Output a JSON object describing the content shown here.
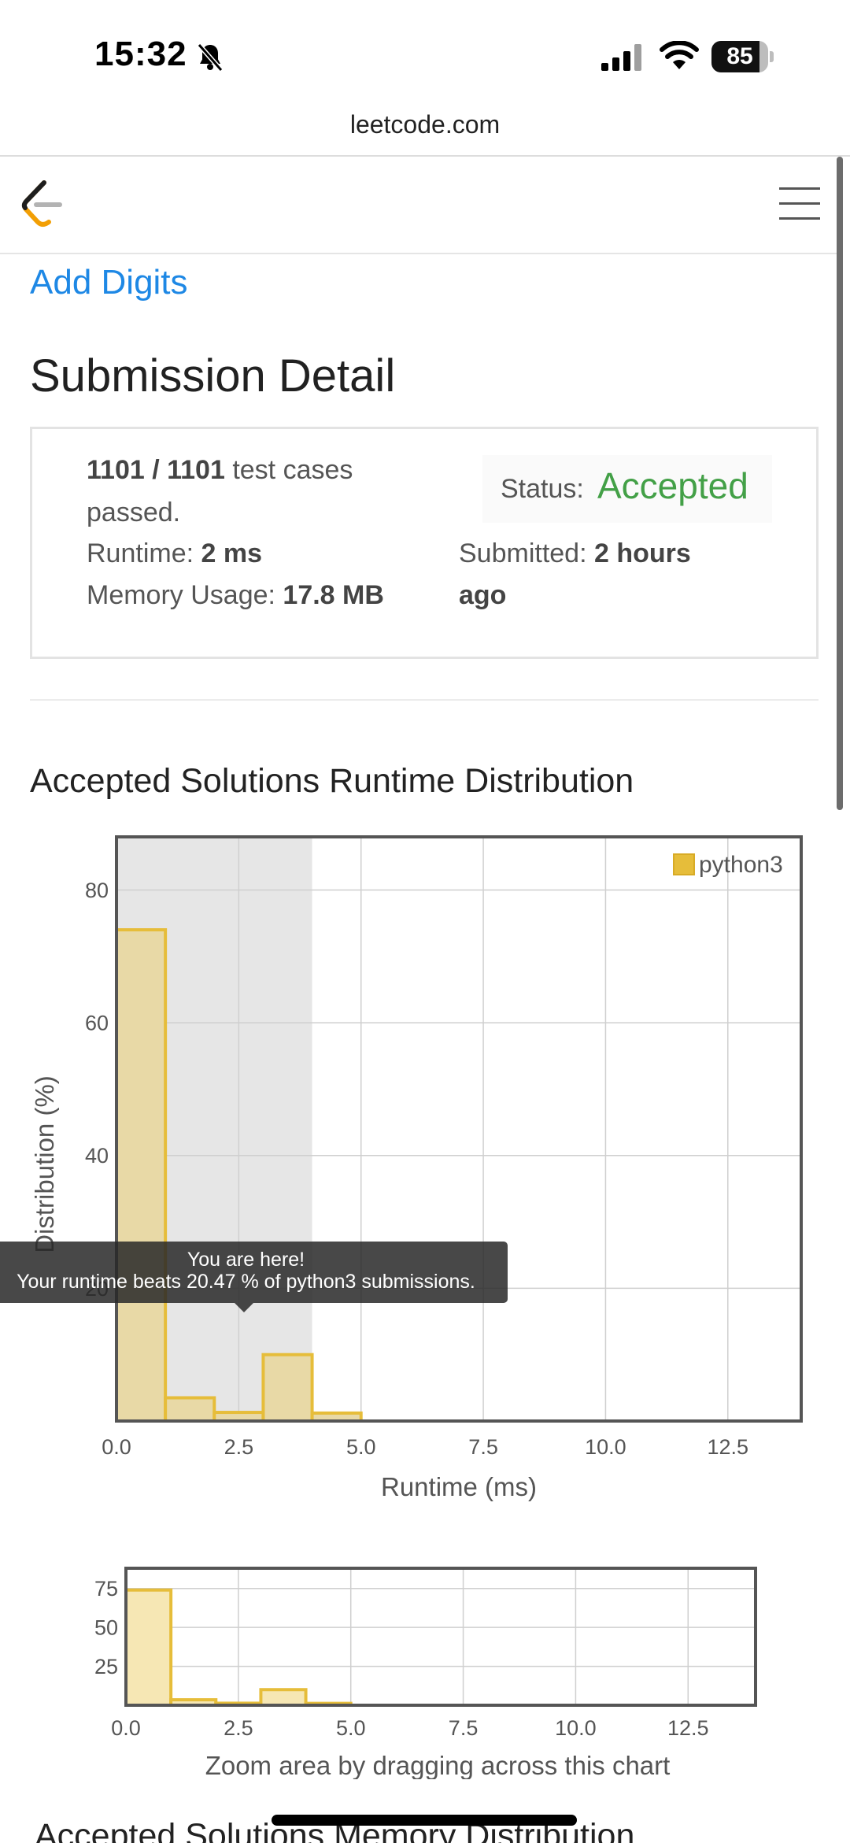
{
  "status_bar": {
    "time": "15:32",
    "battery_level": "85",
    "battery_fraction": 0.85
  },
  "browser": {
    "url": "leetcode.com"
  },
  "header": {
    "logo_icon": "leetcode-logo-icon",
    "menu_icon": "hamburger-menu-icon"
  },
  "problem": {
    "link_label": "Add Digits"
  },
  "page_title": "Submission Detail",
  "submission": {
    "cases_passed": "1101 / 1101",
    "cases_suffix_line1": "test cases",
    "cases_suffix_line2": "passed.",
    "runtime_label": "Runtime:",
    "runtime_value": "2 ms",
    "memory_label": "Memory Usage:",
    "memory_value": "17.8 MB",
    "status_label": "Status:",
    "status_value": "Accepted",
    "submitted_label": "Submitted:",
    "submitted_value_line1": "2 hours",
    "submitted_value_line2": "ago"
  },
  "runtime_section": {
    "title": "Accepted Solutions Runtime Distribution"
  },
  "tooltip": {
    "line1": "You are here!",
    "line2": "Your runtime beats 20.47 % of python3 submissions."
  },
  "chart_data": [
    {
      "type": "bar",
      "title": "",
      "xlabel": "Runtime (ms)",
      "ylabel": "Distribution (%)",
      "x_ticks": [
        "0.0",
        "2.5",
        "5.0",
        "7.5",
        "10.0",
        "12.5"
      ],
      "y_ticks": [
        "20",
        "40",
        "60",
        "80"
      ],
      "xlim": [
        0,
        14
      ],
      "ylim": [
        0,
        88
      ],
      "grid": true,
      "legend_position": "top-right",
      "highlight_range_ms": [
        0,
        4
      ],
      "bins": [
        [
          0,
          1
        ],
        [
          1,
          2
        ],
        [
          2,
          3
        ],
        [
          3,
          4
        ],
        [
          4,
          5
        ]
      ],
      "series": [
        {
          "name": "python3",
          "values": [
            74,
            3.5,
            1.3,
            10,
            1.2
          ]
        }
      ],
      "colors": {
        "bar_fill": "#e8d9a6",
        "bar_stroke": "#e6bd3a",
        "highlight": "#e6e6e6"
      }
    },
    {
      "type": "bar",
      "title": "",
      "xlabel": "Zoom area by dragging across this chart",
      "ylabel": "",
      "x_ticks": [
        "0.0",
        "2.5",
        "5.0",
        "7.5",
        "10.0",
        "12.5"
      ],
      "y_ticks": [
        "25",
        "50",
        "75"
      ],
      "xlim": [
        0,
        14
      ],
      "ylim": [
        0,
        88
      ],
      "grid": true,
      "bins": [
        [
          0,
          1
        ],
        [
          1,
          2
        ],
        [
          2,
          3
        ],
        [
          3,
          4
        ],
        [
          4,
          5
        ]
      ],
      "series": [
        {
          "values": [
            74,
            3.5,
            1.3,
            10,
            1.2
          ]
        }
      ],
      "colors": {
        "bar_fill": "#f6e7b4",
        "bar_stroke": "#e6bd3a"
      }
    }
  ],
  "next_section_title": "Accepted Solutions Memory Distribution"
}
